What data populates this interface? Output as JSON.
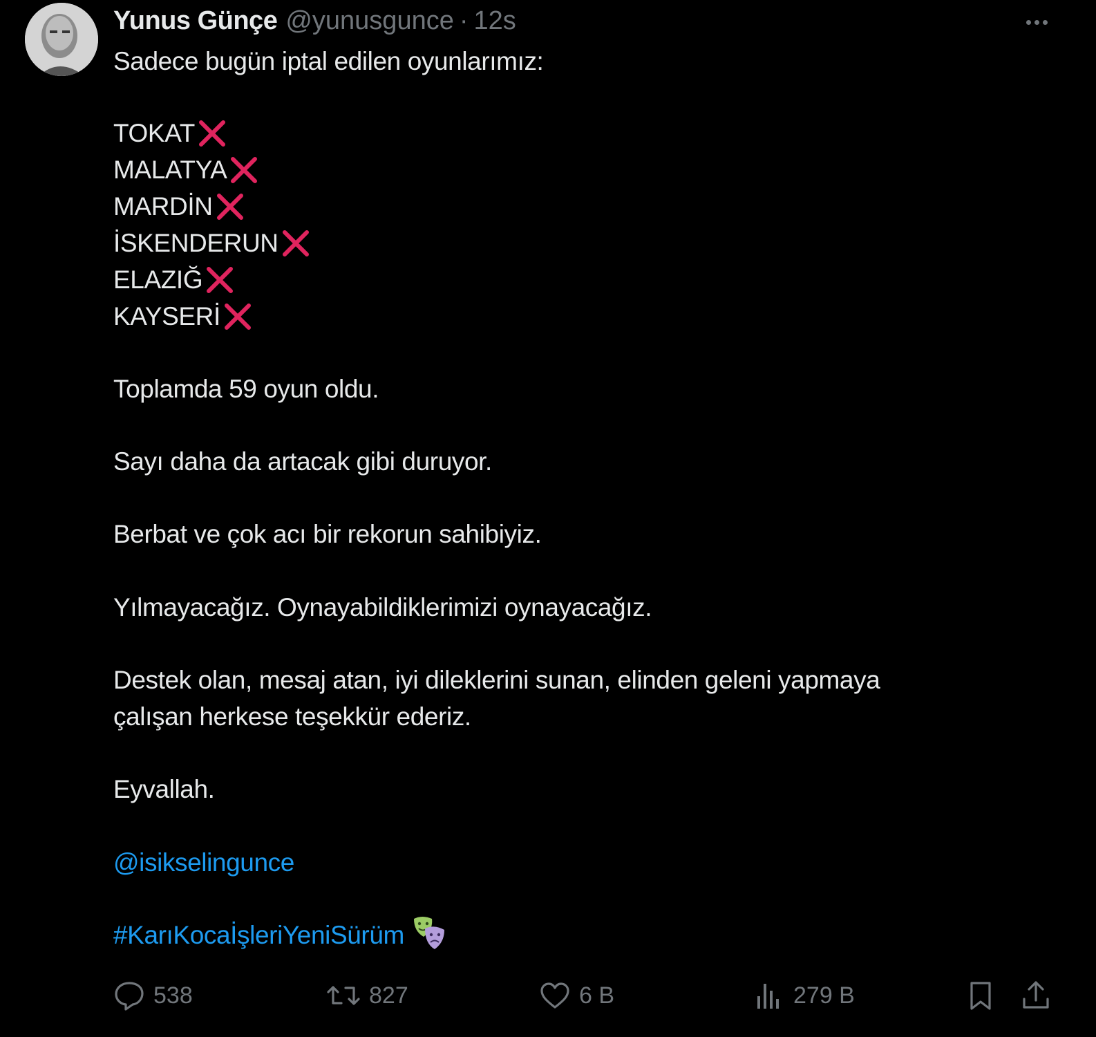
{
  "author": {
    "display_name": "Yunus Günçe",
    "handle": "@yunusgunce",
    "separator": "·",
    "time": "12s"
  },
  "tweet": {
    "intro": "Sadece bugün iptal edilen oyunlarımız:",
    "cities": [
      "TOKAT",
      "MALATYA",
      "MARDİN",
      "İSKENDERUN",
      "ELAZIĞ",
      "KAYSERİ"
    ],
    "cross_icon": "cross-mark-icon",
    "paragraphs": [
      "Toplamda 59 oyun oldu.",
      "Sayı daha da artacak gibi duruyor.",
      "Berbat ve çok acı bir rekorun sahibiyiz.",
      "Yılmayacağız. Oynayabildiklerimizi oynayacağız.",
      "Destek olan, mesaj atan, iyi dileklerini sunan, elinden geleni yapmaya",
      "çalışan herkese teşekkür ederiz.",
      "Eyvallah."
    ],
    "mention": "@isikselingunce",
    "hashtag": "#KarıKocaİşleriYeniSürüm",
    "emoji_icon": "performing-arts-masks-icon"
  },
  "actions": {
    "replies": "538",
    "reposts": "827",
    "likes": "6 B",
    "views": "279 B"
  },
  "colors": {
    "background": "#000000",
    "text": "#e7e9ea",
    "muted": "#71767b",
    "link": "#1d9bf0",
    "cross": "#e0245e"
  }
}
